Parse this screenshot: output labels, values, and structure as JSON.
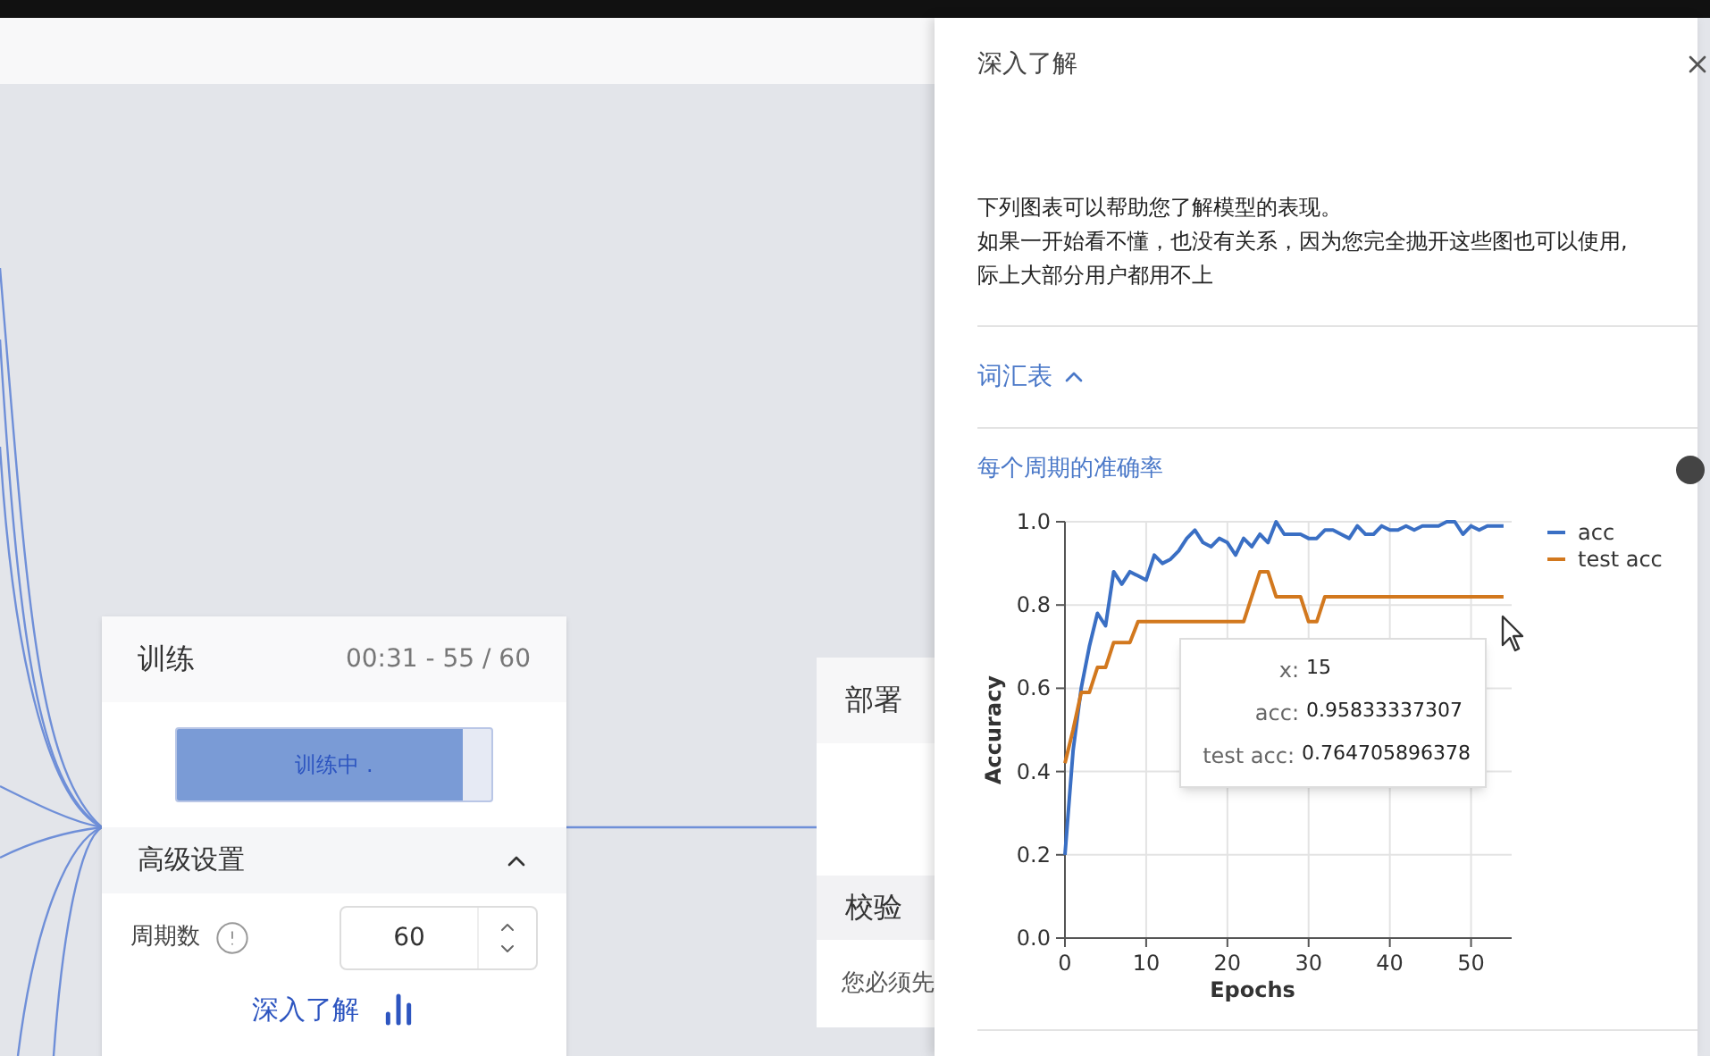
{
  "train_card": {
    "title": "训练",
    "timer": "00:31 - 55 / 60",
    "progress": {
      "label": "训练中 .",
      "level": 0.91
    },
    "advanced": {
      "title": "高级设置",
      "expanded": true
    },
    "epochs": {
      "label": "周期数",
      "value": "60"
    },
    "learn_more": "深入了解"
  },
  "deploy_card": {
    "title": "部署",
    "check_title": "校验",
    "check_text": "您必须先"
  },
  "panel": {
    "title": "深入了解",
    "intro": [
      "下列图表可以帮助您了解模型的表现。",
      "如果一开始看不懂，也没有关系，因为您完全抛开这些图也可以使用,",
      "际上大部分用户都用不上"
    ],
    "glossary": {
      "label": "词汇表",
      "expanded": true
    },
    "chart_title": "每个周期的准确率",
    "chart_data": {
      "type": "line",
      "grid": true,
      "legend": true,
      "x": [
        0,
        1,
        2,
        3,
        4,
        5,
        6,
        7,
        8,
        9,
        10,
        11,
        12,
        13,
        14,
        15,
        16,
        17,
        18,
        19,
        20,
        21,
        22,
        23,
        24,
        25,
        26,
        27,
        28,
        29,
        30,
        31,
        32,
        33,
        34,
        35,
        36,
        37,
        38,
        39,
        40,
        41,
        42,
        43,
        44,
        45,
        46,
        47,
        48,
        49,
        50,
        51,
        52,
        53,
        54
      ],
      "xlabel": "Epochs",
      "ylabel": "Accuracy",
      "xlim": [
        0,
        55
      ],
      "ylim": [
        0,
        1
      ],
      "xticks": [
        0,
        10,
        20,
        30,
        40,
        50
      ],
      "yticks": [
        {
          "value": 0,
          "label": "0.0"
        },
        {
          "value": 0.2,
          "label": "0.2"
        },
        {
          "value": 0.4,
          "label": "0.4"
        },
        {
          "value": 0.6,
          "label": "0.6"
        },
        {
          "value": 0.8,
          "label": "0.8"
        },
        {
          "value": 1,
          "label": "1.0"
        }
      ],
      "series": [
        {
          "name": "acc",
          "color": "#3a6fc4",
          "values": [
            0.2,
            0.45,
            0.6,
            0.7,
            0.78,
            0.75,
            0.88,
            0.85,
            0.88,
            0.87,
            0.86,
            0.92,
            0.9,
            0.91,
            0.93,
            0.96,
            0.98,
            0.95,
            0.94,
            0.96,
            0.95,
            0.92,
            0.96,
            0.94,
            0.97,
            0.95,
            1.0,
            0.97,
            0.97,
            0.97,
            0.96,
            0.96,
            0.98,
            0.98,
            0.97,
            0.96,
            0.99,
            0.97,
            0.97,
            0.99,
            0.98,
            0.98,
            0.99,
            0.98,
            0.99,
            0.99,
            0.99,
            1.0,
            1.0,
            0.97,
            0.99,
            0.98,
            0.99,
            0.99,
            0.99
          ]
        },
        {
          "name": "test acc",
          "color": "#d2781e",
          "values": [
            0.42,
            0.5,
            0.59,
            0.59,
            0.65,
            0.65,
            0.71,
            0.71,
            0.71,
            0.76,
            0.76,
            0.76,
            0.76,
            0.76,
            0.76,
            0.76,
            0.76,
            0.76,
            0.76,
            0.76,
            0.76,
            0.76,
            0.76,
            0.82,
            0.88,
            0.88,
            0.82,
            0.82,
            0.82,
            0.82,
            0.76,
            0.76,
            0.82,
            0.82,
            0.82,
            0.82,
            0.82,
            0.82,
            0.82,
            0.82,
            0.82,
            0.82,
            0.82,
            0.82,
            0.82,
            0.82,
            0.82,
            0.82,
            0.82,
            0.82,
            0.82,
            0.82,
            0.82,
            0.82,
            0.82
          ]
        }
      ]
    },
    "chart_tooltip": [
      {
        "key": "x:",
        "value": "15"
      },
      {
        "key": "acc:",
        "value": "0.95833337307"
      },
      {
        "key": "test acc:",
        "value": "0.764705896378"
      }
    ]
  }
}
